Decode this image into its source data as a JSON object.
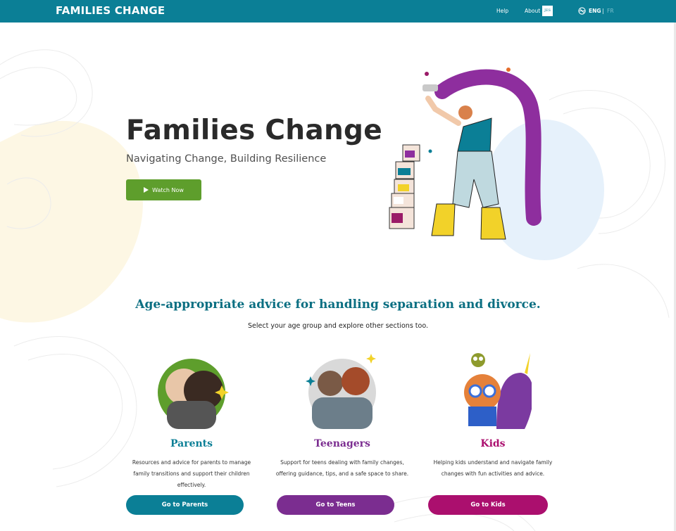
{
  "header": {
    "brand": "FAMILIES CHANGE",
    "help": "Help",
    "about": "About",
    "about_badge": "JES",
    "lang_en": "ENG",
    "lang_sep": "|",
    "lang_fr": "FR"
  },
  "hero": {
    "title": "Families Change",
    "subtitle": "Navigating Change, Building Resilience",
    "watch_label": "Watch Now"
  },
  "section": {
    "title": "Age-appropriate advice for handling separation and divorce.",
    "subtitle": "Select your age group and explore other sections too."
  },
  "cards": [
    {
      "title": "Parents",
      "desc": "Resources and advice for parents to manage family transitions and support their children effectively.",
      "button": "Go to Parents",
      "color": "#0b7f96"
    },
    {
      "title": "Teenagers",
      "desc": "Support for teens dealing with family changes, offering guidance, tips, and a safe space to share.",
      "button": "Go to Teens",
      "color": "#7b2d90"
    },
    {
      "title": "Kids",
      "desc": "Helping kids understand and navigate family changes with fun activities and advice.",
      "button": "Go to Kids",
      "color": "#ab0f6e"
    }
  ],
  "colors": {
    "header_bg": "#0b7f96",
    "watch_button": "#5e9e2c",
    "section_title": "#0b6f82"
  },
  "icons": [
    "globe-icon",
    "play-icon"
  ]
}
